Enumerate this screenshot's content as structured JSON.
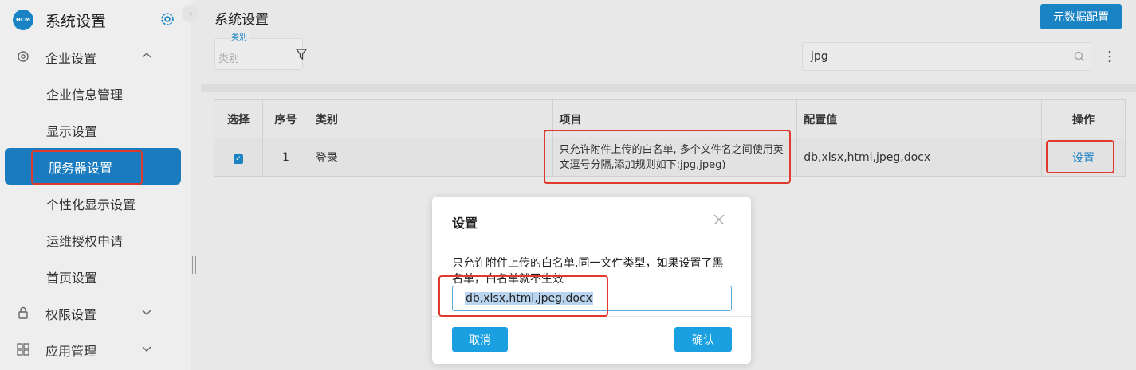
{
  "sidebar": {
    "logo_text": "HCM",
    "title": "系统设置",
    "groups": [
      {
        "label": "企业设置",
        "icon": "settings-icon",
        "expanded": true
      },
      {
        "label": "权限设置",
        "icon": "lock-icon",
        "expanded": false
      },
      {
        "label": "应用管理",
        "icon": "grid-icon",
        "expanded": false
      }
    ],
    "sub_items": [
      {
        "label": "企业信息管理"
      },
      {
        "label": "显示设置"
      },
      {
        "label": "服务器设置",
        "active": true
      },
      {
        "label": "个性化显示设置"
      },
      {
        "label": "运维授权申请"
      },
      {
        "label": "首页设置"
      }
    ]
  },
  "header": {
    "title": "系统设置",
    "meta_button": "元数据配置"
  },
  "filters": {
    "category_legend": "类别",
    "category_placeholder": "类别",
    "search_value": "jpg"
  },
  "table": {
    "columns": [
      "选择",
      "序号",
      "类别",
      "项目",
      "配置值",
      "操作"
    ],
    "rows": [
      {
        "selected": true,
        "index": "1",
        "category": "登录",
        "item": "只允许附件上传的白名单, 多个文件名之间使用英文逗号分隔,添加规则如下:jpg,jpeg)",
        "value": "db,xlsx,html,jpeg,docx",
        "action": "设置"
      }
    ]
  },
  "dialog": {
    "title": "设置",
    "description": "只允许附件上传的白名单,同一文件类型，如果设置了黑名单，白名单就不生效",
    "input_value": "db,xlsx,html,jpeg,docx",
    "cancel": "取消",
    "confirm": "确认"
  },
  "colors": {
    "accent": "#1a83c4",
    "highlight_box": "#e03a2e"
  }
}
